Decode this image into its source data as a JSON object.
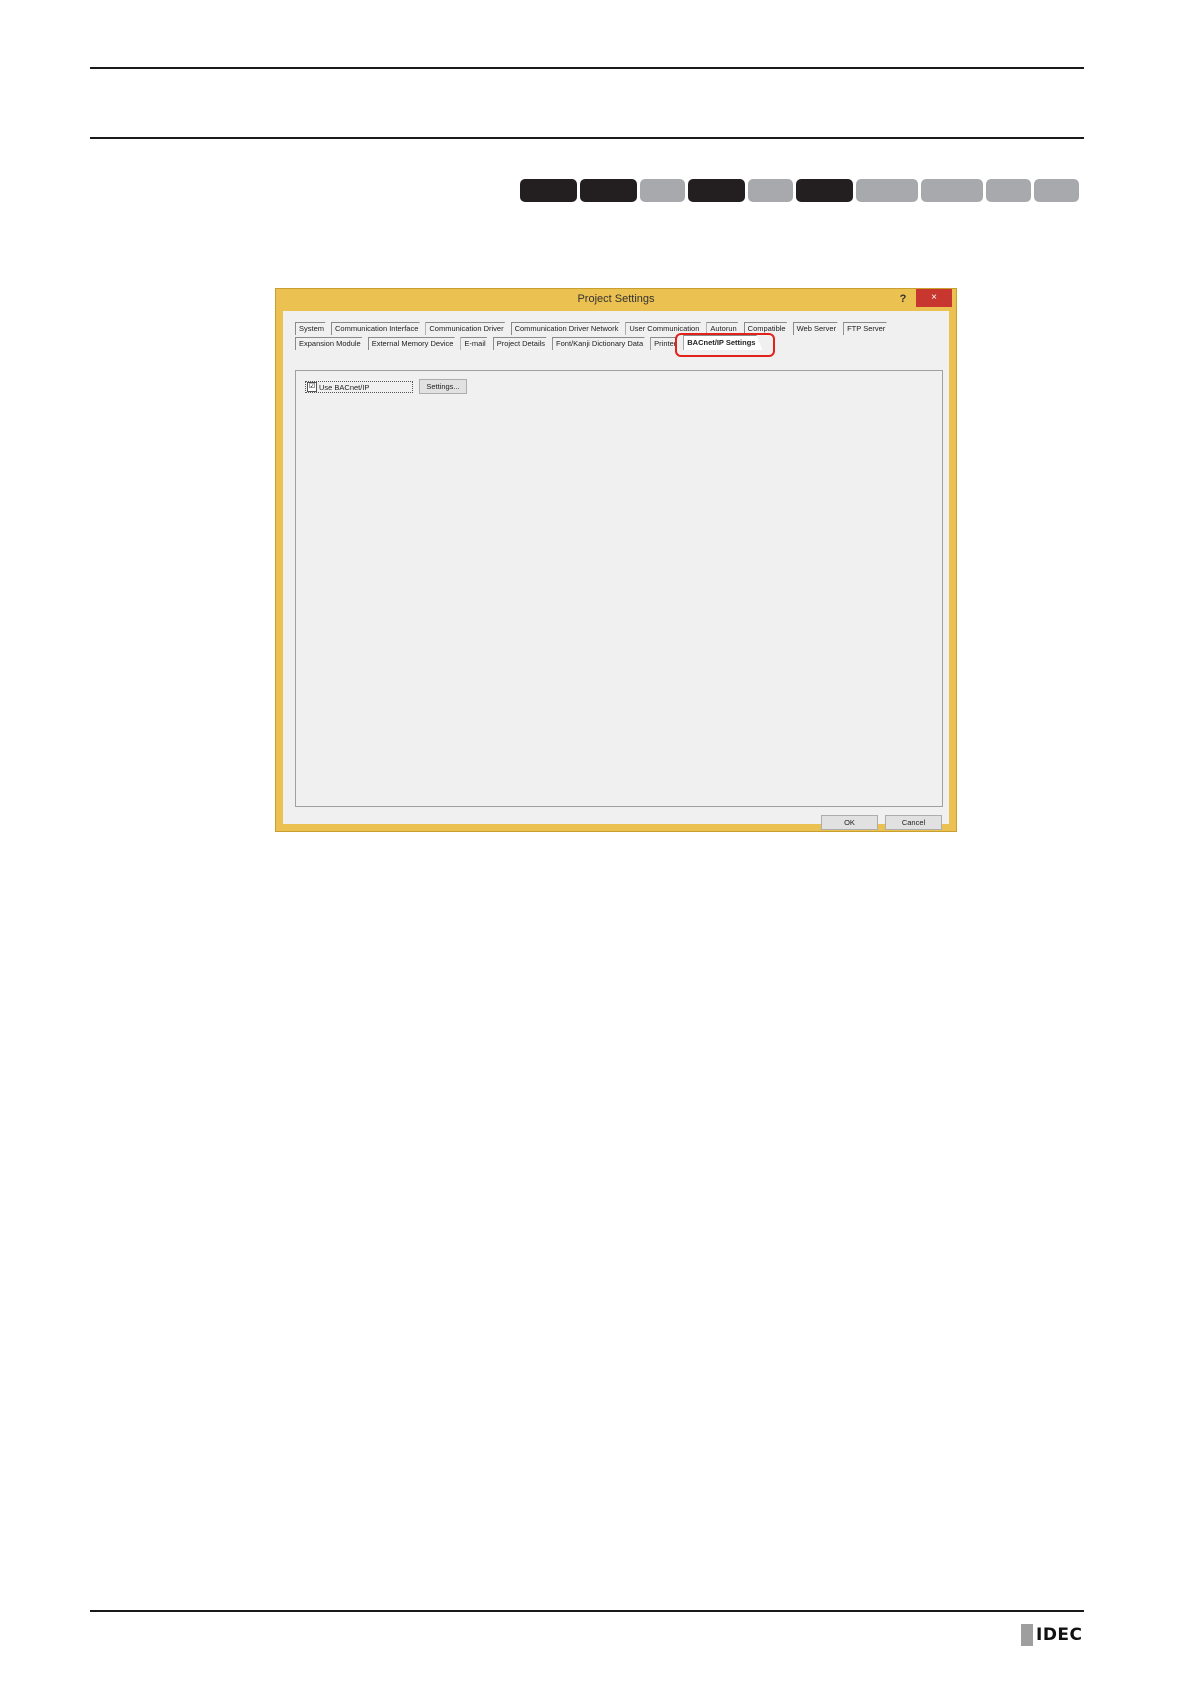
{
  "dialog": {
    "title": "Project Settings",
    "help_label": "?",
    "close_label": "×",
    "tabs_row1": [
      "System",
      "Communication Interface",
      "Communication Driver",
      "Communication Driver Network",
      "User Communication",
      "Autorun",
      "Compatible",
      "Web Server",
      "FTP Server"
    ],
    "tabs_row2": [
      "Expansion Module",
      "External Memory Device",
      "E-mail",
      "Project Details",
      "Font/Kanji Dictionary Data",
      "Printer"
    ],
    "active_tab": "BACnet/IP Settings",
    "use_bacnet": {
      "label": "Use BACnet/IP",
      "checked": "☑"
    },
    "settings_button": "Settings...",
    "ok_button": "OK",
    "cancel_button": "Cancel"
  },
  "footer": {
    "logo": "IDEC"
  },
  "colors": {
    "window_frame": "#ebc152",
    "highlight": "#e2231a",
    "pill_dark": "#231f20",
    "pill_light": "#a7a9ac"
  }
}
